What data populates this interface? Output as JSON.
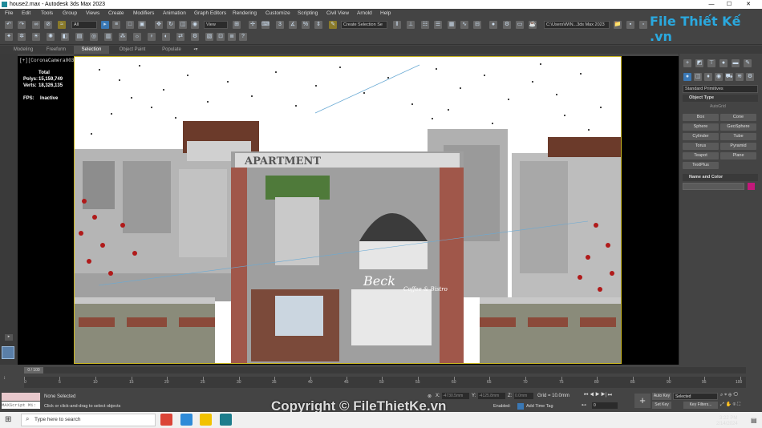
{
  "window": {
    "file": "house2.max",
    "app": "Autodesk 3ds Max 2023",
    "title": "house2.max - Autodesk 3ds Max 2023"
  },
  "menu": [
    "File",
    "Edit",
    "Tools",
    "Group",
    "Views",
    "Create",
    "Modifiers",
    "Animation",
    "Graph Editors",
    "Rendering",
    "Customize",
    "Scripting",
    "Civil View",
    "Arnold",
    "Help"
  ],
  "toolbar": {
    "filter": "All",
    "view": "View",
    "selection_set": "Create Selection Se",
    "path": "C:\\Users\\WIN...3ds Max 2023"
  },
  "ribbon": [
    "Modeling",
    "Freeform",
    "Selection",
    "Object Paint",
    "Populate"
  ],
  "ribbon_selected": "Selection",
  "viewport": {
    "label": "[+][CoronaCamera003][Standard][Default Shading]",
    "stats": {
      "total_label": "Total",
      "polys_label": "Polys:",
      "polys": "15,159,749",
      "verts_label": "Verts:",
      "verts": "18,326,135",
      "fps_label": "FPS:",
      "fps": "Inactive"
    },
    "sign": "APARTMENT",
    "script": "Beck",
    "sub": "Coffee & Bistro"
  },
  "panel": {
    "dropdown": "Standard Primitives",
    "object_type": "Object Type",
    "autogrid": "AutoGrid",
    "buttons": [
      "Box",
      "Cone",
      "Sphere",
      "GeoSphere",
      "Cylinder",
      "Tube",
      "Torus",
      "Pyramid",
      "Teapot",
      "Plane",
      "TextPlus"
    ],
    "name_color": "Name and Color",
    "color": "#c2187a"
  },
  "timeline": {
    "frame": "0 / 100",
    "ticks": [
      "0",
      "5",
      "10",
      "15",
      "20",
      "25",
      "30",
      "35",
      "40",
      "45",
      "50",
      "55",
      "60",
      "65",
      "70",
      "75",
      "80",
      "85",
      "90",
      "95",
      "100"
    ]
  },
  "status": {
    "maxscript": "MAXScript Mi:",
    "selection": "None Selected",
    "hint": "Click or click-and-drag to select objects",
    "x_label": "X:",
    "x": "-4730.5mm",
    "y_label": "Y:",
    "y": "-4125.8mm",
    "z_label": "Z:",
    "z": "0.0mm",
    "grid": "Grid = 10.0mm",
    "enabled": "Enabled:",
    "add_time_tag": "Add Time Tag",
    "auto_key": "Auto Key",
    "set_key": "Set Key",
    "selected": "Selected",
    "key_filters": "Key Filters...",
    "frame": "0"
  },
  "taskbar": {
    "search": "Type here to search",
    "time": "3:22 PM",
    "date": "2/14/2024"
  },
  "watermark": "Copyright © FileThietKe.vn",
  "logo": "File Thiết Kế .vn"
}
